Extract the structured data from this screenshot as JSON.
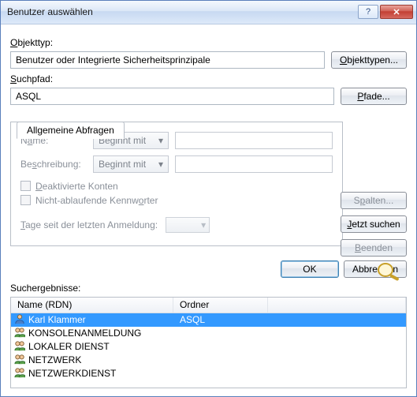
{
  "window": {
    "title": "Benutzer auswählen"
  },
  "labels": {
    "objecttype": "Objekttyp:",
    "searchpath": "Suchpfad:",
    "tab": "Allgemeine Abfragen",
    "name": "Name:",
    "description": "Beschreibung:",
    "beginsWith": "Beginnt mit",
    "deactivated": "Deaktivierte Konten",
    "nonexpiring": "Nicht-ablaufende Kennwörter",
    "daysSince": "Tage seit der letzten Anmeldung:",
    "results": "Suchergebnisse:",
    "colName": "Name (RDN)",
    "colFolder": "Ordner"
  },
  "underline": {
    "objecttype": "O",
    "searchpath": "S",
    "name": "a",
    "description": "s",
    "deactivated": "D",
    "nonexpiring": "o",
    "days": "T",
    "objtypesBtn": "O",
    "pathsBtn": "P",
    "columns": "p",
    "searchnow": "J",
    "quit": "B"
  },
  "fields": {
    "objecttype": "Benutzer oder Integrierte Sicherheitsprinzipale",
    "searchpath": "ASQL"
  },
  "buttons": {
    "objecttypes": "Objekttypen...",
    "paths": "Pfade...",
    "columns": "Spalten...",
    "searchnow": "Jetzt suchen",
    "quit": "Beenden",
    "ok": "OK",
    "cancel": "Abbrechen"
  },
  "results": [
    {
      "name": "Karl Klammer",
      "folder": "ASQL",
      "selected": true,
      "icon": "user"
    },
    {
      "name": "KONSOLENANMELDUNG",
      "folder": "",
      "selected": false,
      "icon": "group"
    },
    {
      "name": "LOKALER DIENST",
      "folder": "",
      "selected": false,
      "icon": "group"
    },
    {
      "name": "NETZWERK",
      "folder": "",
      "selected": false,
      "icon": "group"
    },
    {
      "name": "NETZWERKDIENST",
      "folder": "",
      "selected": false,
      "icon": "group"
    }
  ]
}
